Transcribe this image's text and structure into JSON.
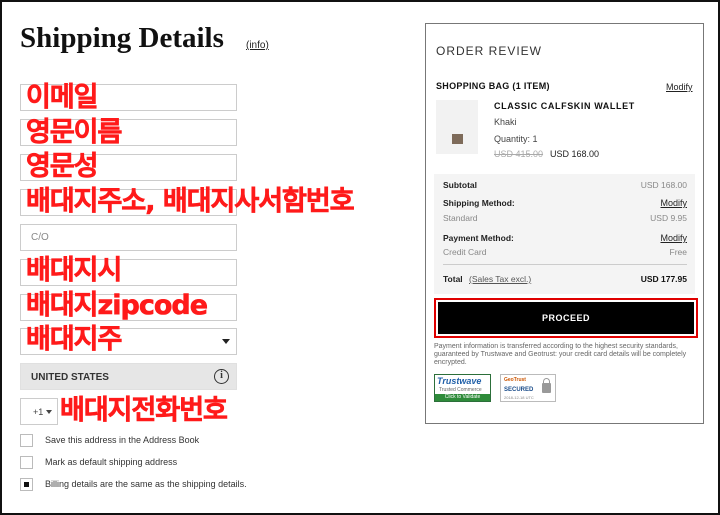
{
  "header": {
    "title": "Shipping Details",
    "info_link": "(info)"
  },
  "form": {
    "annotations": {
      "email": "이메일",
      "english_name": "영문이름",
      "english_surname": "영문성",
      "address": "배대지주소, 배대지사서함번호",
      "city": "배대지시",
      "zipcode": "배대지zipcode",
      "state": "배대지주",
      "phone": "배대지전화번호"
    },
    "co_placeholder": "C/O",
    "country": "UNITED STATES",
    "phone_code": "+1",
    "checkboxes": [
      {
        "label": "Save this address in the Address Book",
        "checked": false
      },
      {
        "label": "Mark as default shipping address",
        "checked": false
      },
      {
        "label": "Billing details are the same as the shipping details.",
        "checked": true
      }
    ]
  },
  "review": {
    "title": "ORDER REVIEW",
    "bag_label": "SHOPPING BAG (1 ITEM)",
    "modify": "Modify",
    "product": {
      "name": "CLASSIC CALFSKIN WALLET",
      "color": "Khaki",
      "quantity": "Quantity: 1",
      "old_price": "USD 415.00",
      "new_price": "USD 168.00"
    },
    "summary": {
      "subtotal_label": "Subtotal",
      "subtotal_value": "USD 168.00",
      "shipping_label": "Shipping Method:",
      "shipping_method": "Standard",
      "shipping_value": "USD 9.95",
      "payment_label": "Payment Method:",
      "payment_method": "Credit Card",
      "payment_value": "Free",
      "total_label": "Total",
      "tax_label": "(Sales Tax excl.)",
      "total_value": "USD 177.95"
    },
    "proceed": "PROCEED",
    "note": "Payment information is transferred according to the highest security standards, guaranteed by Trustwave and Geotrust: your credit card details will be completely encrypted.",
    "badges": {
      "trustwave": "Trustwave",
      "trustwave_sub": "Trusted Commerce",
      "trustwave_cta": "Click to Validate",
      "geotrust": "GeoTrust",
      "geotrust_secured": "SECURED",
      "geotrust_date": "2018-12-18 UTC"
    }
  },
  "colors": {
    "annotation_red": "#ff1a1a",
    "proceed_bg": "#000000",
    "proceed_outline": "#e00000"
  }
}
